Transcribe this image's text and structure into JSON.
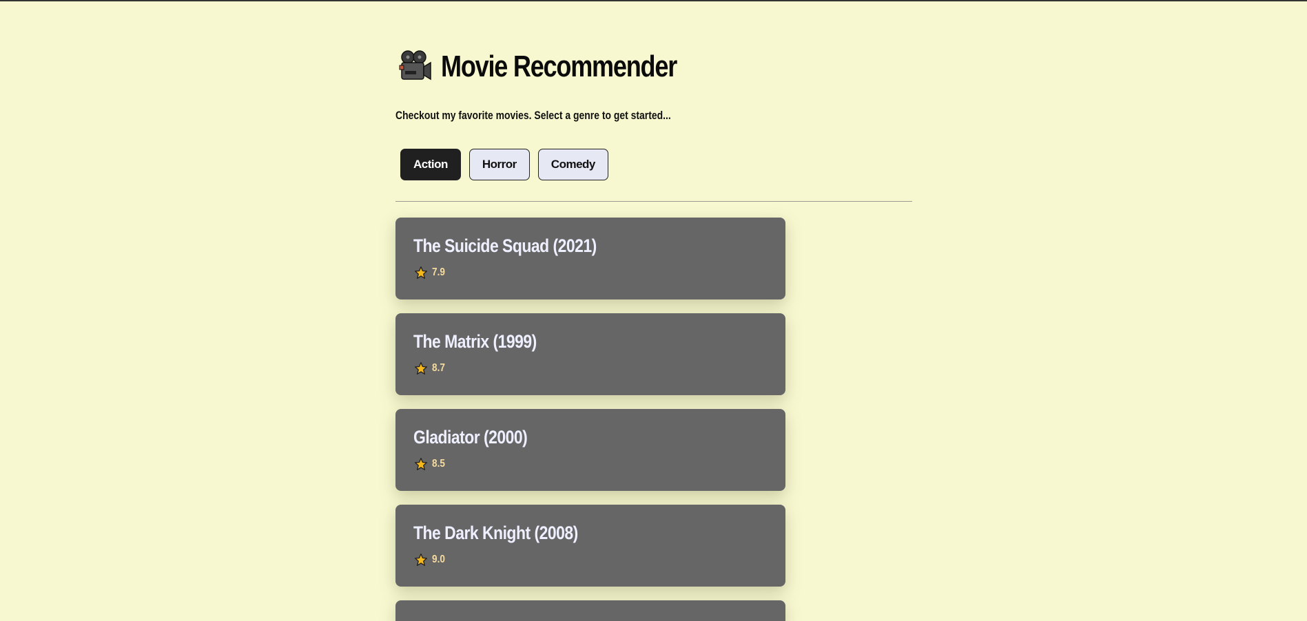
{
  "header": {
    "title": "Movie Recommender",
    "icon": "movie-camera-icon",
    "subtitle": "Checkout my favorite movies. Select a genre to get started..."
  },
  "genres": [
    {
      "label": "Action",
      "active": true
    },
    {
      "label": "Horror",
      "active": false
    },
    {
      "label": "Comedy",
      "active": false
    }
  ],
  "movies": [
    {
      "title": "The Suicide Squad (2021)",
      "rating": "7.9"
    },
    {
      "title": "The Matrix (1999)",
      "rating": "8.7"
    },
    {
      "title": "Gladiator (2000)",
      "rating": "8.5"
    },
    {
      "title": "The Dark Knight (2008)",
      "rating": "9.0"
    },
    {
      "title": "",
      "rating": ""
    }
  ],
  "colors": {
    "background": "#f8f8d0",
    "card": "#666666",
    "active_button": "#202020",
    "button": "#e6e8f4",
    "rating_text": "#f6dca0",
    "star": "#f5b81c"
  }
}
